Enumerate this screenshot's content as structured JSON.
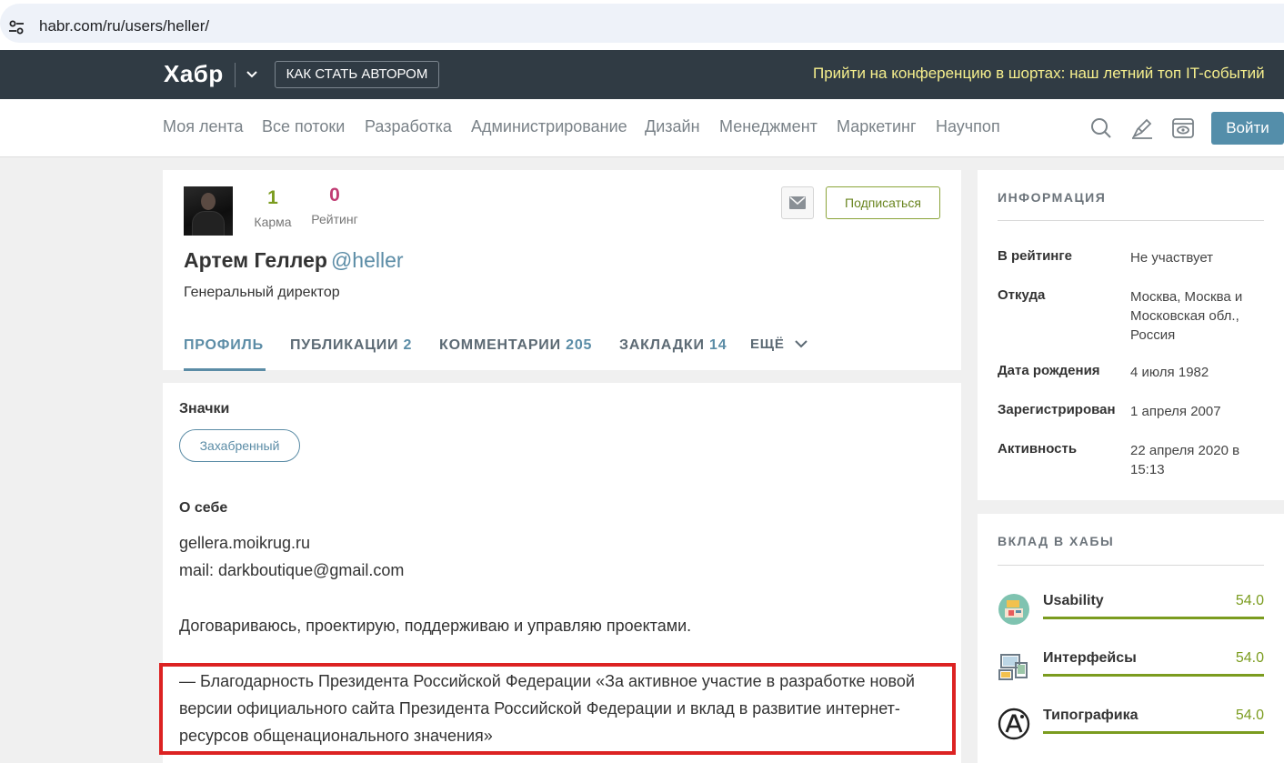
{
  "browser": {
    "url": "habr.com/ru/users/heller/"
  },
  "header": {
    "logo": "Хабр",
    "author_button": "КАК СТАТЬ АВТОРОМ",
    "promo": "Прийти на конференцию в шортах: наш летний топ IT-событий"
  },
  "nav": {
    "items": [
      "Моя лента",
      "Все потоки",
      "Разработка",
      "Администрирование",
      "Дизайн",
      "Менеджмент",
      "Маркетинг",
      "Научпоп"
    ],
    "login": "Войти",
    "icons": [
      "search-icon",
      "pen-icon",
      "eye-icon"
    ]
  },
  "profile": {
    "karma": "1",
    "karma_label": "Карма",
    "rating": "0",
    "rating_label": "Рейтинг",
    "subscribe": "Подписаться",
    "name": "Артем Геллер",
    "nick": "@heller",
    "job": "Генеральный директор",
    "tabs": [
      {
        "label": "ПРОФИЛЬ",
        "count": ""
      },
      {
        "label": "ПУБЛИКАЦИИ",
        "count": "2"
      },
      {
        "label": "КОММЕНТАРИИ",
        "count": "205"
      },
      {
        "label": "ЗАКЛАДКИ",
        "count": "14"
      },
      {
        "label": "ЕЩЁ",
        "count": ""
      }
    ]
  },
  "about": {
    "badges_title": "Значки",
    "badge": "Захабренный",
    "about_title": "О себе",
    "line1": "gellera.moikrug.ru",
    "line2": "mail: darkboutique@gmail.com",
    "line3": "Договариваюсь, проектирую, поддерживаю и управляю проектами.",
    "quote": "— Благодарность Президента Российской Федерации «За активное участие в разработке новой версии официального сайта Президента Российской Федерации и вклад в развитие интернет-ресурсов общенационального значения»"
  },
  "info": {
    "title": "ИНФОРМАЦИЯ",
    "rows": [
      {
        "k": "В рейтинге",
        "v": "Не участвует"
      },
      {
        "k": "Откуда",
        "v": "Москва, Москва и Московская обл., Россия"
      },
      {
        "k": "Дата рождения",
        "v": "4 июля 1982"
      },
      {
        "k": "Зарегистрирован",
        "v": "1 апреля 2007"
      },
      {
        "k": "Активность",
        "v": "22 апреля 2020 в 15:13"
      }
    ]
  },
  "hubs": {
    "title": "ВКЛАД В ХАБЫ",
    "items": [
      {
        "name": "Usability",
        "value": "54.0"
      },
      {
        "name": "Интерфейсы",
        "value": "54.0"
      },
      {
        "name": "Типографика",
        "value": "54.0"
      }
    ]
  },
  "colors": {
    "header_bg": "#303b44",
    "accent": "#5b8ca6",
    "karma": "#7b9c1f",
    "rating": "#c03c73",
    "highlight": "#dc2222"
  }
}
